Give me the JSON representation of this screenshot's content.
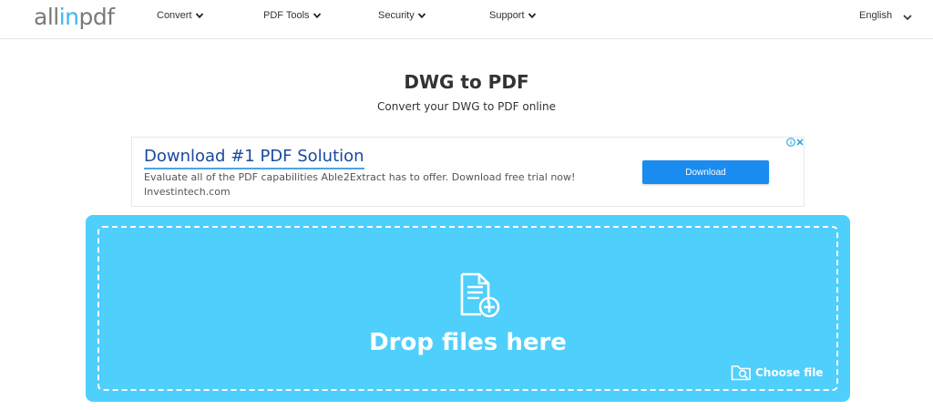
{
  "header": {
    "logo_prefix": "all",
    "logo_mid": "in",
    "logo_suffix": "pdf",
    "nav": [
      {
        "label": "Convert"
      },
      {
        "label": "PDF Tools"
      },
      {
        "label": "Security"
      },
      {
        "label": "Support"
      }
    ],
    "language": "English"
  },
  "main": {
    "title": "DWG to PDF",
    "subtitle": "Convert your DWG to PDF online"
  },
  "ad": {
    "headline": "Download #1 PDF Solution",
    "description": "Evaluate all of the PDF capabilities Able2Extract has to offer. Download free trial now!",
    "domain": "Investintech.com",
    "button_label": "Download"
  },
  "dropzone": {
    "text": "Drop files here",
    "choose_file_label": "Choose file"
  },
  "colors": {
    "brand_blue": "#3fb6f2",
    "dropzone_bg": "#4fcffb",
    "ad_button": "#1a8cf0",
    "ad_headline": "#1a4aa0"
  },
  "icons": {
    "nav_chevron": "chevron-down-icon",
    "file": "file-add-icon",
    "choose_file": "folder-search-icon",
    "ad_info": "info-icon",
    "ad_close": "close-icon"
  }
}
